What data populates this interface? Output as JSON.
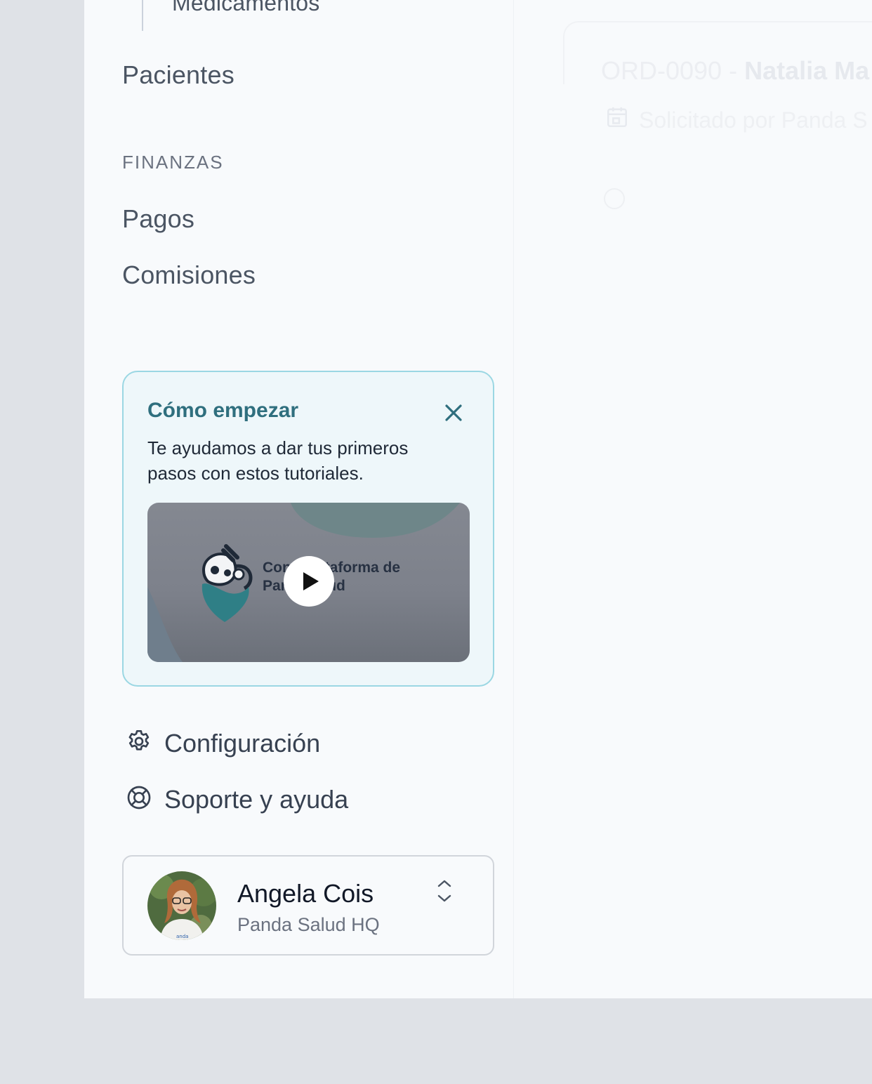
{
  "sidebar": {
    "sub_item": "Medicamentos",
    "item_pacientes": "Pacientes",
    "section_finanzas": "FINANZAS",
    "item_pagos": "Pagos",
    "item_comisiones": "Comisiones"
  },
  "tutorial": {
    "title": "Cómo empezar",
    "description": "Te ayudamos a dar tus primeros pasos con estos tutoriales.",
    "video_caption": "Con   plataforma de\nPar          ud"
  },
  "links": {
    "settings": "Configuración",
    "support": "Soporte y ayuda"
  },
  "user": {
    "name": "Angela Cois",
    "org": "Panda Salud HQ"
  },
  "main": {
    "order_id": "ORD-0090 - ",
    "patient": "Natalia Ma",
    "requested_by": "Solicitado por Panda S"
  },
  "colors": {
    "accent": "#2f6f7e",
    "card_border": "#9bd7e3",
    "card_bg": "#eef7fa"
  }
}
